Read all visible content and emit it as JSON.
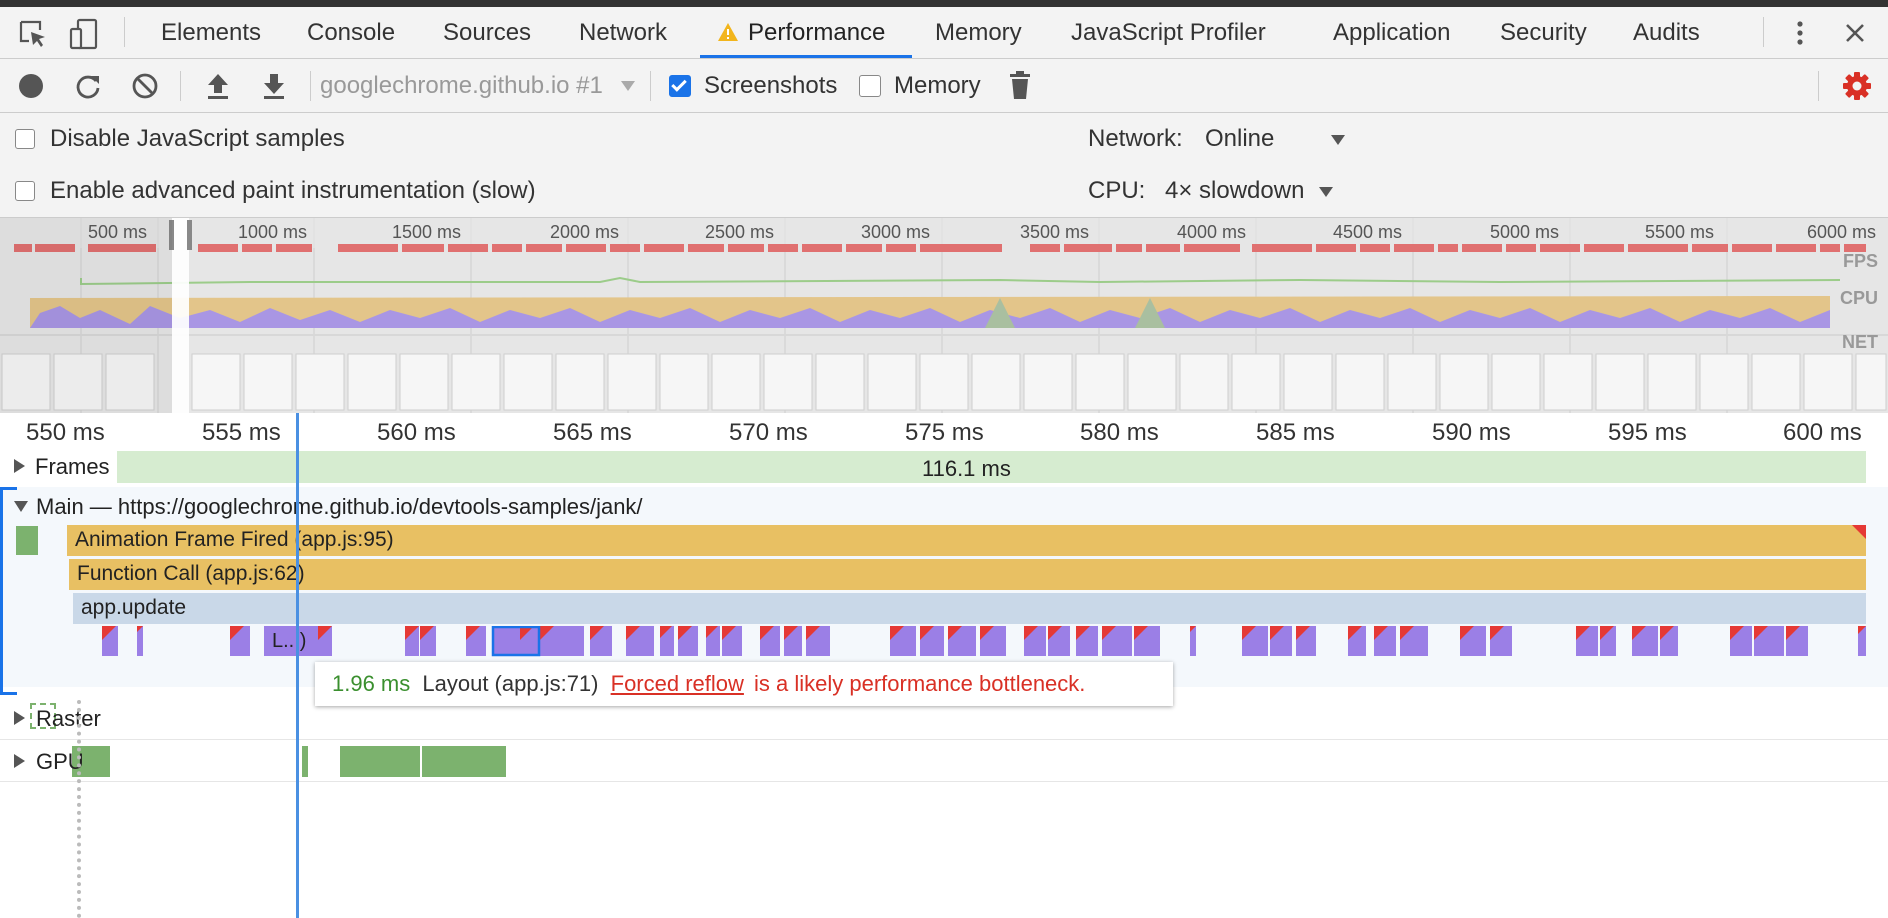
{
  "tabs": {
    "elements": "Elements",
    "console": "Console",
    "sources": "Sources",
    "network": "Network",
    "performance": "Performance",
    "memory": "Memory",
    "js_profiler": "JavaScript Profiler",
    "application": "Application",
    "security": "Security",
    "audits": "Audits"
  },
  "toolbar": {
    "recording_select": "googlechrome.github.io #1",
    "screenshots_label": "Screenshots",
    "screenshots_checked": true,
    "memory_label": "Memory",
    "memory_checked": false
  },
  "settings": {
    "disable_js_samples": "Disable JavaScript samples",
    "advanced_paint": "Enable advanced paint instrumentation (slow)",
    "network_label": "Network:",
    "network_value": "Online",
    "cpu_label": "CPU:",
    "cpu_value": "4× slowdown"
  },
  "overview": {
    "ticks": [
      "500 ms",
      "1000 ms",
      "1500 ms",
      "2000 ms",
      "2500 ms",
      "3000 ms",
      "3500 ms",
      "4000 ms",
      "4500 ms",
      "5000 ms",
      "5500 ms",
      "6000 ms"
    ],
    "fps_label": "FPS",
    "cpu_label": "CPU",
    "net_label": "NET"
  },
  "ruler": {
    "ticks": [
      "550 ms",
      "555 ms",
      "560 ms",
      "565 ms",
      "570 ms",
      "575 ms",
      "580 ms",
      "585 ms",
      "590 ms",
      "595 ms",
      "600 ms"
    ]
  },
  "tracks": {
    "frames_label": "Frames",
    "frames_duration": "116.1 ms",
    "main_label": "Main — https://googlechrome.github.io/devtools-samples/jank/",
    "animation_frame": "Animation Frame Fired (app.js:95)",
    "function_call": "Function Call (app.js:62)",
    "app_update": "app.update",
    "layout_short": "L...)",
    "raster_label": "Raster",
    "gpu_label": "GPU"
  },
  "tooltip": {
    "duration": "1.96 ms",
    "name": "Layout (app.js:71)",
    "link": "Forced reflow",
    "message": "is a likely performance bottleneck."
  },
  "colors": {
    "accent": "#1a73e8",
    "scripting": "#e8c063",
    "app_update": "#c9d8e8",
    "layout": "#9b7fe6",
    "gpu": "#7cb26e",
    "frames": "#d6ecd0",
    "warning_red": "#e53935",
    "fps_bar": "#e07070",
    "link_red": "#d93025",
    "duration_green": "#3a8f2e"
  }
}
